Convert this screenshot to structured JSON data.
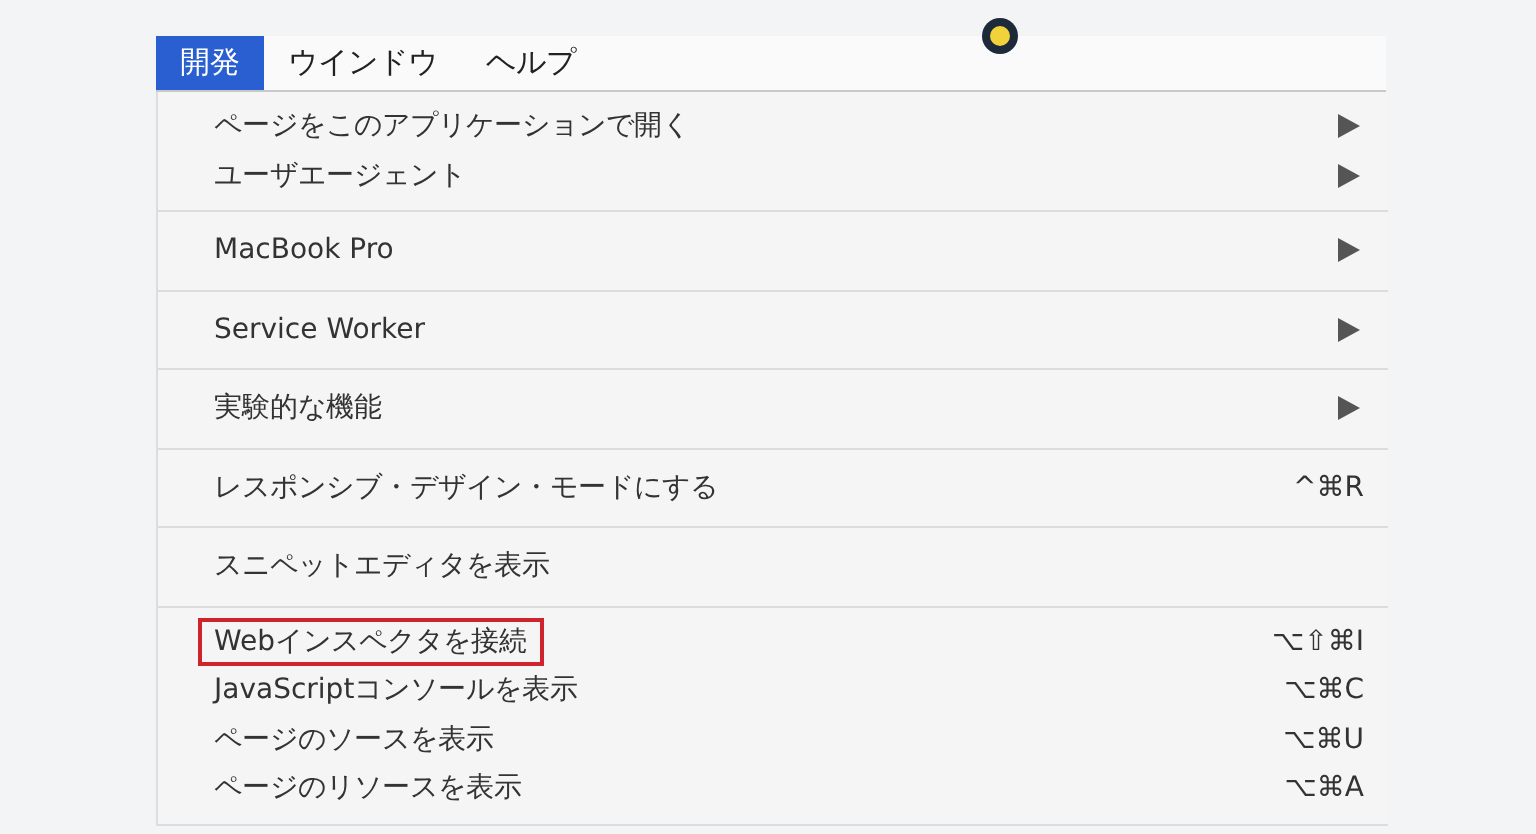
{
  "menubar": [
    {
      "label": "開発",
      "selected": true
    },
    {
      "label": "ウインドウ",
      "selected": false
    },
    {
      "label": "ヘルプ",
      "selected": false
    }
  ],
  "menu": {
    "groups": [
      {
        "items": [
          {
            "label": "ページをこのアプリケーションで開く",
            "submenu": true,
            "outlined": false
          },
          {
            "label": "ユーザエージェント",
            "submenu": true,
            "outlined": false
          }
        ]
      },
      {
        "items": [
          {
            "label": "MacBook Pro",
            "submenu": true,
            "outlined": false
          }
        ]
      },
      {
        "items": [
          {
            "label": "Service Worker",
            "submenu": true,
            "outlined": false
          }
        ]
      },
      {
        "items": [
          {
            "label": "実験的な機能",
            "submenu": true,
            "outlined": false
          }
        ]
      },
      {
        "items": [
          {
            "label": "レスポンシブ・デザイン・モードにする",
            "shortcut": "^⌘R",
            "submenu": false,
            "outlined": false
          }
        ]
      },
      {
        "items": [
          {
            "label": "スニペットエディタを表示",
            "submenu": false,
            "outlined": false
          }
        ]
      },
      {
        "items": [
          {
            "label": "Webインスペクタを接続",
            "shortcut": "⌥⇧⌘I",
            "submenu": false,
            "outlined": true
          },
          {
            "label": "JavaScriptコンソールを表示",
            "shortcut": "⌥⌘C",
            "submenu": false,
            "outlined": false
          },
          {
            "label": "ページのソースを表示",
            "shortcut": "⌥⌘U",
            "submenu": false,
            "outlined": false
          },
          {
            "label": "ページのリソースを表示",
            "shortcut": "⌥⌘A",
            "submenu": false,
            "outlined": false
          }
        ]
      }
    ]
  }
}
